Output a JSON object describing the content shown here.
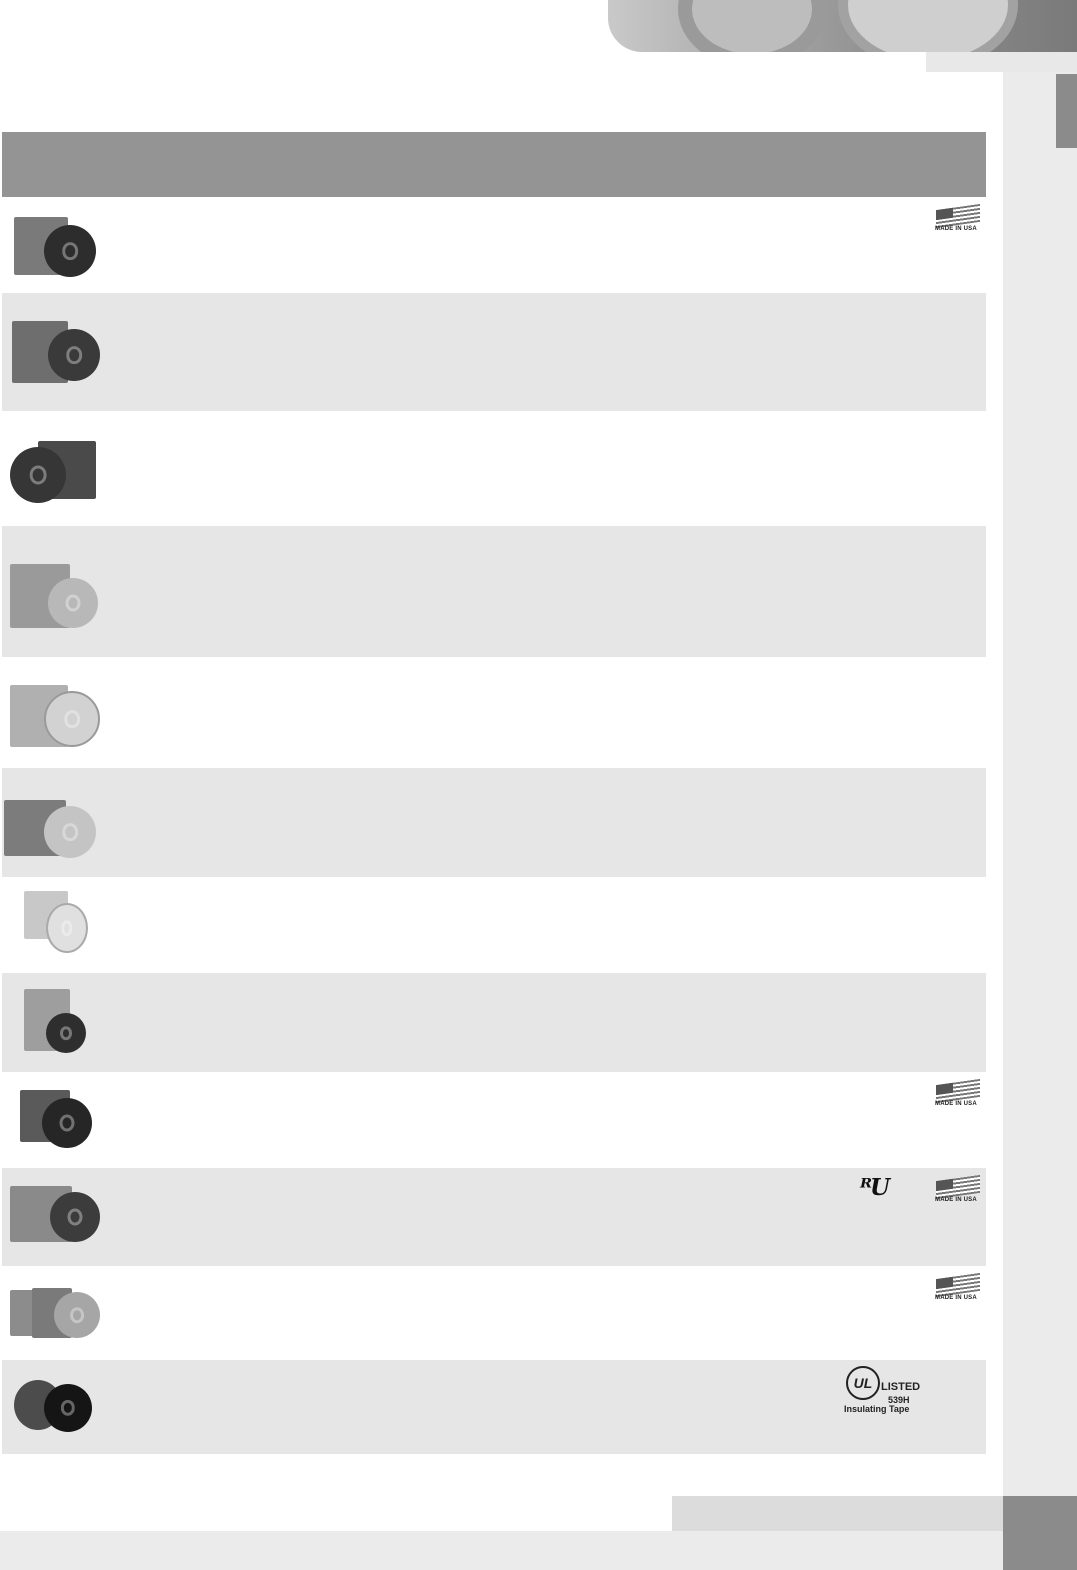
{
  "colors": {
    "header_band": "#949494",
    "row_shade": "#e6e6e6",
    "side_strip": "#ebebeb",
    "accent_dark": "#8b8b8b"
  },
  "badges": {
    "made_in_usa": "MADE IN USA",
    "ul_listed": "LISTED",
    "ul_number": "539H",
    "ul_caption": "Insulating Tape",
    "ul_letters": "UL",
    "ur_mark": "ᴿU"
  },
  "rows": [
    {
      "icon": "dark-tape-roll-with-box",
      "badges": [
        "made-in-usa"
      ]
    },
    {
      "icon": "dark-tape-roll-with-box",
      "badges": []
    },
    {
      "icon": "dark-tape-roll-with-box",
      "badges": []
    },
    {
      "icon": "light-tape-roll-with-box",
      "badges": []
    },
    {
      "icon": "clear-tape-roll-with-box",
      "badges": []
    },
    {
      "icon": "light-tape-roll-with-box",
      "badges": []
    },
    {
      "icon": "clear-tape-roll-with-box",
      "badges": []
    },
    {
      "icon": "dark-tape-roll-in-pack",
      "badges": []
    },
    {
      "icon": "dark-tape-roll-with-box",
      "badges": [
        "made-in-usa"
      ]
    },
    {
      "icon": "dark-tape-roll-with-box",
      "badges": [
        "ur-recognized",
        "made-in-usa"
      ]
    },
    {
      "icon": "tape-rolls-with-boxes",
      "badges": [
        "made-in-usa"
      ]
    },
    {
      "icon": "dark-tape-roll-with-box",
      "badges": [
        "ul-listed"
      ]
    }
  ]
}
